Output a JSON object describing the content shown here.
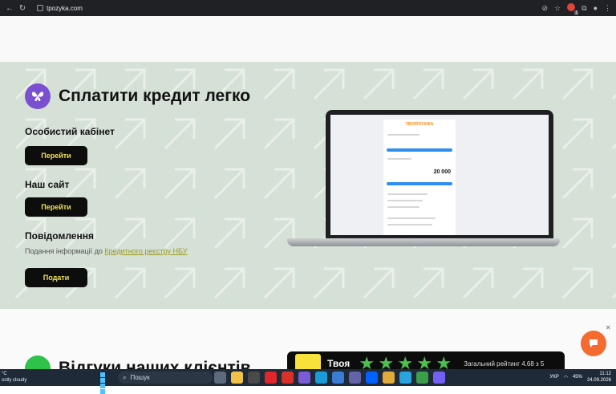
{
  "browser": {
    "url": "tpozyka.com",
    "extension_badge_count": "1"
  },
  "hero": {
    "title": "Сплатити кредит легко",
    "cabinet_label": "Особистий кабінет",
    "cabinet_button": "Перейти",
    "site_label": "Наш сайт",
    "site_button": "Перейти",
    "notify_label": "Повідомлення",
    "notify_text": "Подання інформації до ",
    "notify_link": "Кредитного реєстру НБУ",
    "submit_button": "Подати"
  },
  "laptop_screen": {
    "app_logo": "ТВОЯПОЗИКА",
    "amount": "20 000"
  },
  "reviews": {
    "title": "Відгуки наших клієнтів",
    "brand": "Твоя",
    "rating_text": "Загальний рейтинг 4.68 з 5",
    "stars": 5
  },
  "colors": {
    "hero_bg": "#d5e0d6",
    "button_bg": "#0d0d0d",
    "button_text": "#f2e24a",
    "accent_purple": "#7a4fd0",
    "accent_green": "#2fc24a",
    "chat_orange": "#f46a2f"
  },
  "taskbar": {
    "weather_temp": "°C",
    "weather_text": "ostly cloudy",
    "search_placeholder": "Пошук",
    "language": "УКР",
    "battery": "45%",
    "time": "11:12",
    "date": "24.09.2026"
  }
}
